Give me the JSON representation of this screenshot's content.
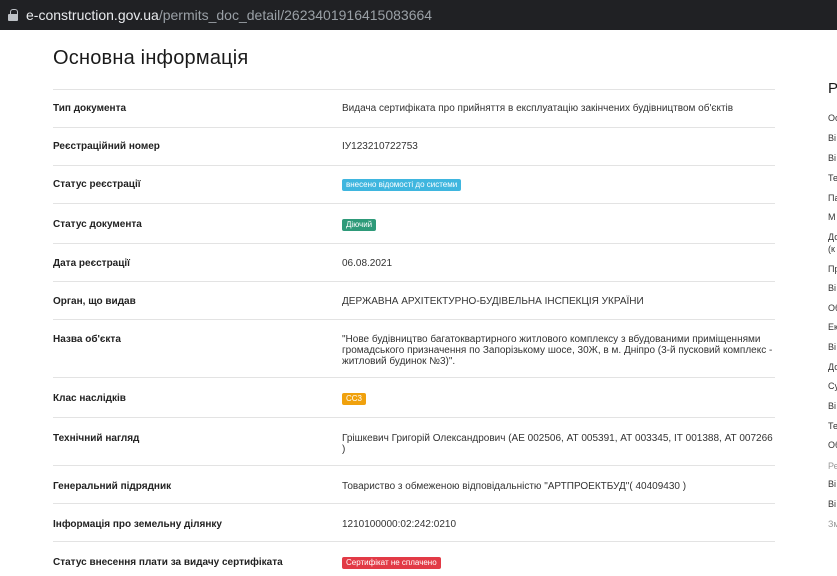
{
  "browser": {
    "url_domain": "e-construction.gov.ua",
    "url_path": "/permits_doc_detail/2623401916415083664"
  },
  "page": {
    "title": "Основна інформація"
  },
  "rows": [
    {
      "label": "Тип документа",
      "value": "Видача сертифіката про прийняття в експлуатацію закінчених будівництвом об'єктів"
    },
    {
      "label": "Реєстраційний номер",
      "value": "ІУ123210722753"
    },
    {
      "label": "Статус реєстрації",
      "badge": "внесено відомості до системи",
      "badge_color": "#3fb6df"
    },
    {
      "label": "Статус документа",
      "badge": "Діючий",
      "badge_color": "#2e9a79"
    },
    {
      "label": "Дата реєстрації",
      "value": "06.08.2021"
    },
    {
      "label": "Орган, що видав",
      "value": "ДЕРЖАВНА АРХІТЕКТУРНО-БУДІВЕЛЬНА ІНСПЕКЦІЯ УКРАЇНИ"
    },
    {
      "label": "Назва об'єкта",
      "value": "\"Нове будівництво багатоквартирного житлового комплексу з вбудованими приміщеннями громадського призначення по Запорізькому шосе, 30Ж, в м. Дніпро (3-й пусковий комплекс - житловий будинок №3)\"."
    },
    {
      "label": "Клас наслідків",
      "badge": "СС3",
      "badge_color": "#f0a10d"
    },
    {
      "label": "Технічний нагляд",
      "value": "Грішкевич Григорій Олександрович (АЕ 002506, АТ 005391, АТ 003345, ІТ 001388, АТ 007266 )"
    },
    {
      "label": "Генеральний підрядник",
      "value": "Товариство з обмеженою відповідальністю \"АРТПРОЕКТБУД\"( 40409430 )"
    },
    {
      "label": "Інформація про земельну ділянку",
      "value": "1210100000:02:242:0210"
    },
    {
      "label": "Статус внесення плати за видачу сертифіката",
      "badge": "Сертифікат не сплачено",
      "badge_color": "#e23a46"
    }
  ],
  "sidebar": {
    "heading": "Р",
    "items": [
      {
        "label": "Ос"
      },
      {
        "label": "Ві"
      },
      {
        "label": "Ві"
      },
      {
        "label": "Те"
      },
      {
        "label": "Па"
      },
      {
        "label": "М"
      },
      {
        "label": "До"
      },
      {
        "label": "(к"
      },
      {
        "label": "Пр"
      },
      {
        "label": "Ві"
      },
      {
        "label": "Об"
      },
      {
        "label": "Ек"
      },
      {
        "label": "Ві"
      },
      {
        "label": "До"
      },
      {
        "label": "Су"
      },
      {
        "label": "Ві"
      },
      {
        "label": "Те"
      },
      {
        "label": "Об"
      },
      {
        "label": "Ре",
        "muted": true
      },
      {
        "label": "Ві"
      },
      {
        "label": "Ві"
      },
      {
        "label": "Зм",
        "muted": true
      }
    ]
  }
}
